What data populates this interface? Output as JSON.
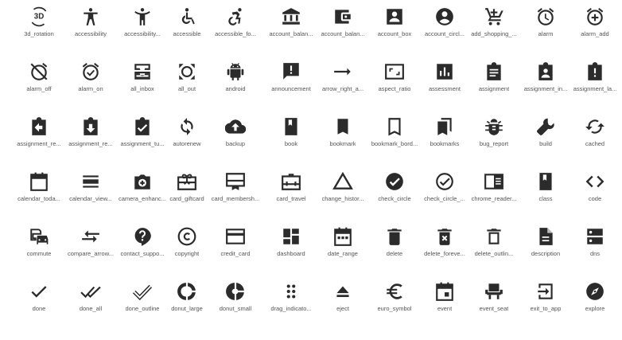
{
  "icons": [
    {
      "label": "3d_rotation",
      "icon": "3d-rotation-icon"
    },
    {
      "label": "accessibility",
      "icon": "accessibility-icon"
    },
    {
      "label": "accessibility...",
      "icon": "accessibility-new-icon"
    },
    {
      "label": "accessible",
      "icon": "accessible-icon"
    },
    {
      "label": "accessible_fo...",
      "icon": "accessible-forward-icon"
    },
    {
      "label": "account_balan...",
      "icon": "account-balance-icon"
    },
    {
      "label": "account_balan...",
      "icon": "account-balance-wallet-icon"
    },
    {
      "label": "account_box",
      "icon": "account-box-icon"
    },
    {
      "label": "account_circl...",
      "icon": "account-circle-icon"
    },
    {
      "label": "add_shopping_...",
      "icon": "add-shopping-cart-icon"
    },
    {
      "label": "alarm",
      "icon": "alarm-icon"
    },
    {
      "label": "alarm_add",
      "icon": "alarm-add-icon"
    },
    {
      "label": "alarm_off",
      "icon": "alarm-off-icon"
    },
    {
      "label": "alarm_on",
      "icon": "alarm-on-icon"
    },
    {
      "label": "all_inbox",
      "icon": "all-inbox-icon"
    },
    {
      "label": "all_out",
      "icon": "all-out-icon"
    },
    {
      "label": "android",
      "icon": "android-icon"
    },
    {
      "label": "announcement",
      "icon": "announcement-icon"
    },
    {
      "label": "arrow_right_a...",
      "icon": "arrow-right-alt-icon"
    },
    {
      "label": "aspect_ratio",
      "icon": "aspect-ratio-icon"
    },
    {
      "label": "assessment",
      "icon": "assessment-icon"
    },
    {
      "label": "assignment",
      "icon": "assignment-icon"
    },
    {
      "label": "assignment_in...",
      "icon": "assignment-ind-icon"
    },
    {
      "label": "assignment_la...",
      "icon": "assignment-late-icon"
    },
    {
      "label": "assignment_re...",
      "icon": "assignment-return-icon"
    },
    {
      "label": "assignment_re...",
      "icon": "assignment-returned-icon"
    },
    {
      "label": "assignment_tu...",
      "icon": "assignment-turned-in-icon"
    },
    {
      "label": "autorenew",
      "icon": "autorenew-icon"
    },
    {
      "label": "backup",
      "icon": "backup-icon"
    },
    {
      "label": "book",
      "icon": "book-icon"
    },
    {
      "label": "bookmark",
      "icon": "bookmark-icon"
    },
    {
      "label": "bookmark_bord...",
      "icon": "bookmark-border-icon"
    },
    {
      "label": "bookmarks",
      "icon": "bookmarks-icon"
    },
    {
      "label": "bug_report",
      "icon": "bug-report-icon"
    },
    {
      "label": "build",
      "icon": "build-icon"
    },
    {
      "label": "cached",
      "icon": "cached-icon"
    },
    {
      "label": "calendar_toda...",
      "icon": "calendar-today-icon"
    },
    {
      "label": "calendar_view...",
      "icon": "calendar-view-day-icon"
    },
    {
      "label": "camera_enhanc...",
      "icon": "camera-enhance-icon"
    },
    {
      "label": "card_giftcard",
      "icon": "card-giftcard-icon"
    },
    {
      "label": "card_membersh...",
      "icon": "card-membership-icon"
    },
    {
      "label": "card_travel",
      "icon": "card-travel-icon"
    },
    {
      "label": "change_histor...",
      "icon": "change-history-icon"
    },
    {
      "label": "check_circle",
      "icon": "check-circle-icon"
    },
    {
      "label": "check_circle_...",
      "icon": "check-circle-outline-icon"
    },
    {
      "label": "chrome_reader...",
      "icon": "chrome-reader-mode-icon"
    },
    {
      "label": "class",
      "icon": "class-icon"
    },
    {
      "label": "code",
      "icon": "code-icon"
    },
    {
      "label": "commute",
      "icon": "commute-icon"
    },
    {
      "label": "compare_arrow...",
      "icon": "compare-arrows-icon"
    },
    {
      "label": "contact_suppo...",
      "icon": "contact-support-icon"
    },
    {
      "label": "copyright",
      "icon": "copyright-icon"
    },
    {
      "label": "credit_card",
      "icon": "credit-card-icon"
    },
    {
      "label": "dashboard",
      "icon": "dashboard-icon"
    },
    {
      "label": "date_range",
      "icon": "date-range-icon"
    },
    {
      "label": "delete",
      "icon": "delete-icon"
    },
    {
      "label": "delete_foreve...",
      "icon": "delete-forever-icon"
    },
    {
      "label": "delete_outlin...",
      "icon": "delete-outline-icon"
    },
    {
      "label": "description",
      "icon": "description-icon"
    },
    {
      "label": "dns",
      "icon": "dns-icon"
    },
    {
      "label": "done",
      "icon": "done-icon"
    },
    {
      "label": "done_all",
      "icon": "done-all-icon"
    },
    {
      "label": "done_outline",
      "icon": "done-outline-icon"
    },
    {
      "label": "donut_large",
      "icon": "donut-large-icon"
    },
    {
      "label": "donut_small",
      "icon": "donut-small-icon"
    },
    {
      "label": "drag_indicato...",
      "icon": "drag-indicator-icon"
    },
    {
      "label": "eject",
      "icon": "eject-icon"
    },
    {
      "label": "euro_symbol",
      "icon": "euro-symbol-icon"
    },
    {
      "label": "event",
      "icon": "event-icon"
    },
    {
      "label": "event_seat",
      "icon": "event-seat-icon"
    },
    {
      "label": "exit_to_app",
      "icon": "exit-to-app-icon"
    },
    {
      "label": "explore",
      "icon": "explore-icon"
    }
  ]
}
